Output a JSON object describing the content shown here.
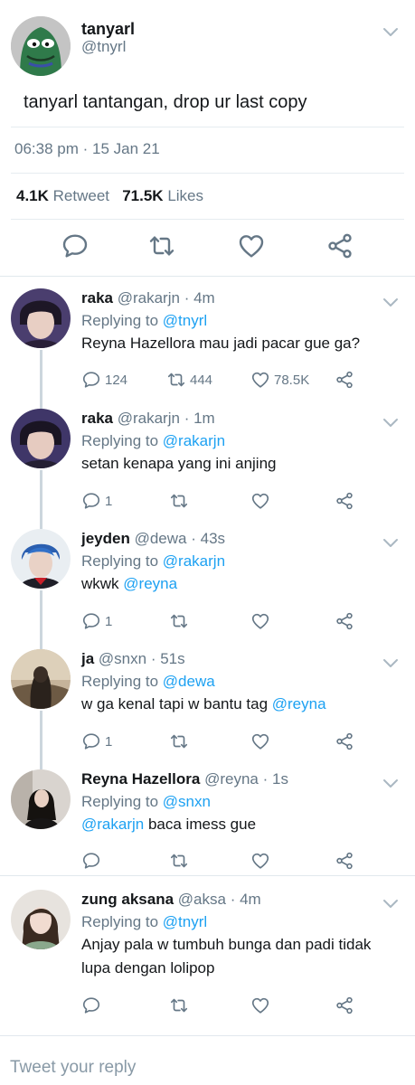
{
  "main_tweet": {
    "name": "tanyarl",
    "handle": "@tnyrl",
    "text": "tanyarl tantangan, drop ur last copy",
    "timestamp": "06:38 pm · 15 Jan 21",
    "retweets_count": "4.1K",
    "retweets_label": "Retweet",
    "likes_count": "71.5K",
    "likes_label": "Likes"
  },
  "replies": [
    {
      "name": "raka",
      "handle": "@rakarjn",
      "time": "· 4m",
      "replying_prefix": "Replying to",
      "replying_to": "@tnyrl",
      "text": "Reyna Hazellora mau jadi pacar gue ga?",
      "replies_count": "124",
      "retweets_count": "444",
      "likes_count": "78.5K"
    },
    {
      "name": "raka",
      "handle": "@rakarjn",
      "time": "· 1m",
      "replying_prefix": "Replying to",
      "replying_to": "@rakarjn",
      "text": "setan kenapa yang ini anjing",
      "replies_count": "1"
    },
    {
      "name": "jeyden",
      "handle": "@dewa",
      "time": "· 43s",
      "replying_prefix": "Replying to",
      "replying_to": "@rakarjn",
      "text_prefix": "wkwk",
      "mention": "@reyna",
      "replies_count": "1"
    },
    {
      "name": "ja",
      "handle": "@snxn",
      "time": "· 51s",
      "replying_prefix": "Replying to",
      "replying_to": "@dewa",
      "text_prefix": "w ga kenal tapi w bantu tag",
      "mention": "@reyna",
      "replies_count": "1"
    },
    {
      "name": "Reyna Hazellora",
      "handle": "@reyna",
      "time": "· 1s",
      "replying_prefix": "Replying to",
      "replying_to": "@snxn",
      "mention": "@rakarjn",
      "text_suffix": "baca imess gue"
    },
    {
      "name": "zung aksana",
      "handle": "@aksa",
      "time": "· 4m",
      "replying_prefix": "Replying to",
      "replying_to": "@tnyrl",
      "text": "Anjay pala w tumbuh bunga dan padi tidak lupa dengan lolipop"
    }
  ],
  "composer": {
    "placeholder": "Tweet your reply"
  },
  "colors": {
    "link": "#1da1f2",
    "secondary_text": "#657786",
    "icon": "#657786",
    "thread_line": "#ccd6dd",
    "divider": "#e1e8ed"
  },
  "icons": [
    "chevron-down-icon",
    "reply-icon",
    "retweet-icon",
    "like-icon",
    "share-icon"
  ]
}
